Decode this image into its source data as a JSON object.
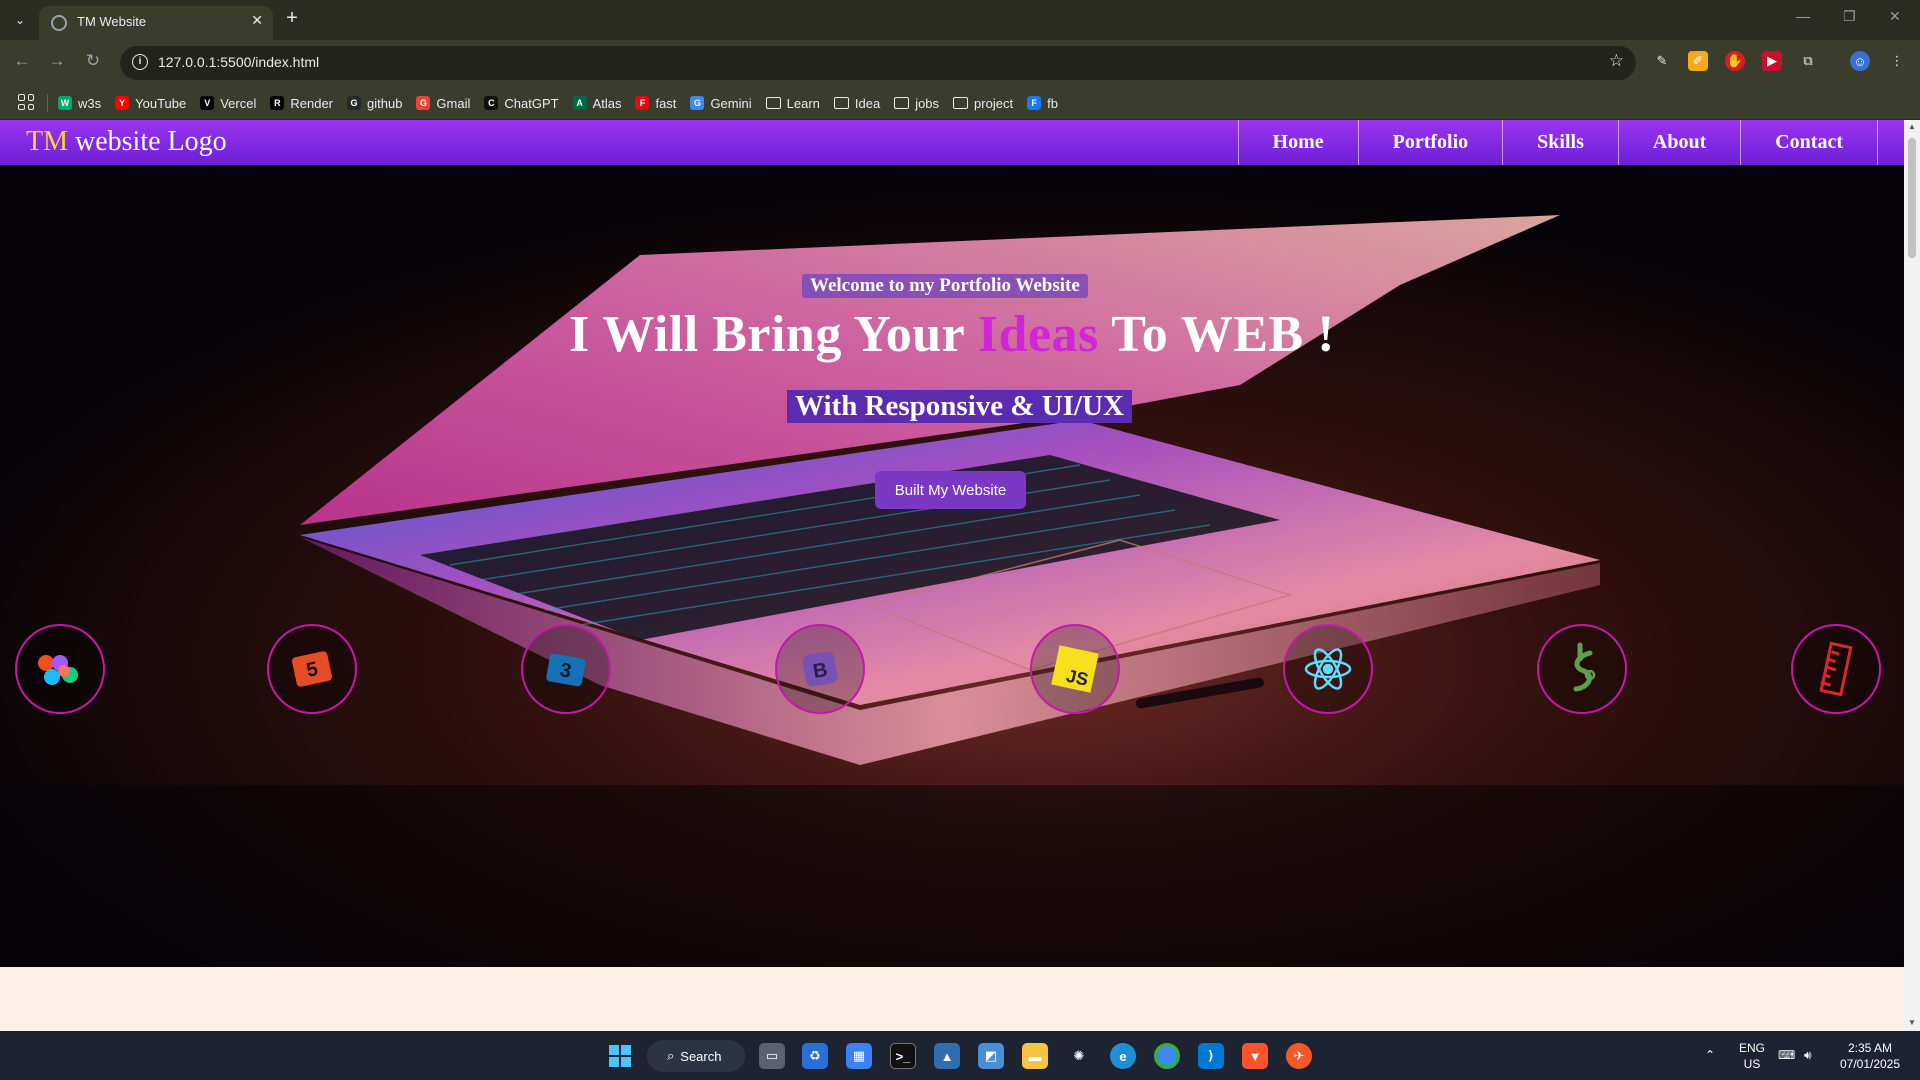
{
  "browser": {
    "tab_title": "TM Website",
    "url": "127.0.0.1:5500/index.html",
    "bookmarks": [
      {
        "label": "w3s",
        "icon": "w3s-icon",
        "color": "#04aa6d"
      },
      {
        "label": "YouTube",
        "icon": "youtube-icon",
        "color": "#ff0000"
      },
      {
        "label": "Vercel",
        "icon": "vercel-icon",
        "color": "#000000"
      },
      {
        "label": "Render",
        "icon": "render-icon",
        "color": "#000000"
      },
      {
        "label": "github",
        "icon": "github-icon",
        "color": "#24292e"
      },
      {
        "label": "Gmail",
        "icon": "gmail-icon",
        "color": "#ea4335"
      },
      {
        "label": "ChatGPT",
        "icon": "chatgpt-icon",
        "color": "#111111"
      },
      {
        "label": "Atlas",
        "icon": "atlas-icon",
        "color": "#00684a"
      },
      {
        "label": "fast",
        "icon": "fast-icon",
        "color": "#e50914"
      },
      {
        "label": "Gemini",
        "icon": "gemini-icon",
        "color": "#4285f4"
      },
      {
        "label": "Learn",
        "icon": "folder-icon",
        "color": ""
      },
      {
        "label": "Idea",
        "icon": "folder-icon",
        "color": ""
      },
      {
        "label": "jobs",
        "icon": "folder-icon",
        "color": ""
      },
      {
        "label": "project",
        "icon": "folder-icon",
        "color": ""
      },
      {
        "label": "fb",
        "icon": "facebook-icon",
        "color": "#1877f2"
      }
    ]
  },
  "site": {
    "logo_tm": "TM",
    "logo_text": " website Logo",
    "nav": [
      "Home",
      "Portfolio",
      "Skills",
      "About",
      "Contact"
    ],
    "hero": {
      "welcome": "Welcome to my Portfolio Website",
      "headline_before": "I Will Bring Your ",
      "headline_highlight": "Ideas",
      "headline_after": " To WEB !",
      "subheadline": "With Responsive & UI/UX",
      "cta_label": "Built My Website"
    },
    "tech_icons": [
      "figma-icon",
      "html5-icon",
      "css3-icon",
      "bootstrap-icon",
      "javascript-icon",
      "react-icon",
      "nodejs-icon",
      "ruler-icon"
    ],
    "colors": {
      "header_accent": "#8a2be2",
      "logo_tm": "#ffd23a",
      "ideas": "#d026d8",
      "icon_ring": "#c21aa8",
      "cta": "#7a38c4"
    }
  },
  "taskbar": {
    "search_label": "Search",
    "lang_1": "ENG",
    "lang_2": "US",
    "time": "2:35 AM",
    "date": "07/01/2025"
  }
}
